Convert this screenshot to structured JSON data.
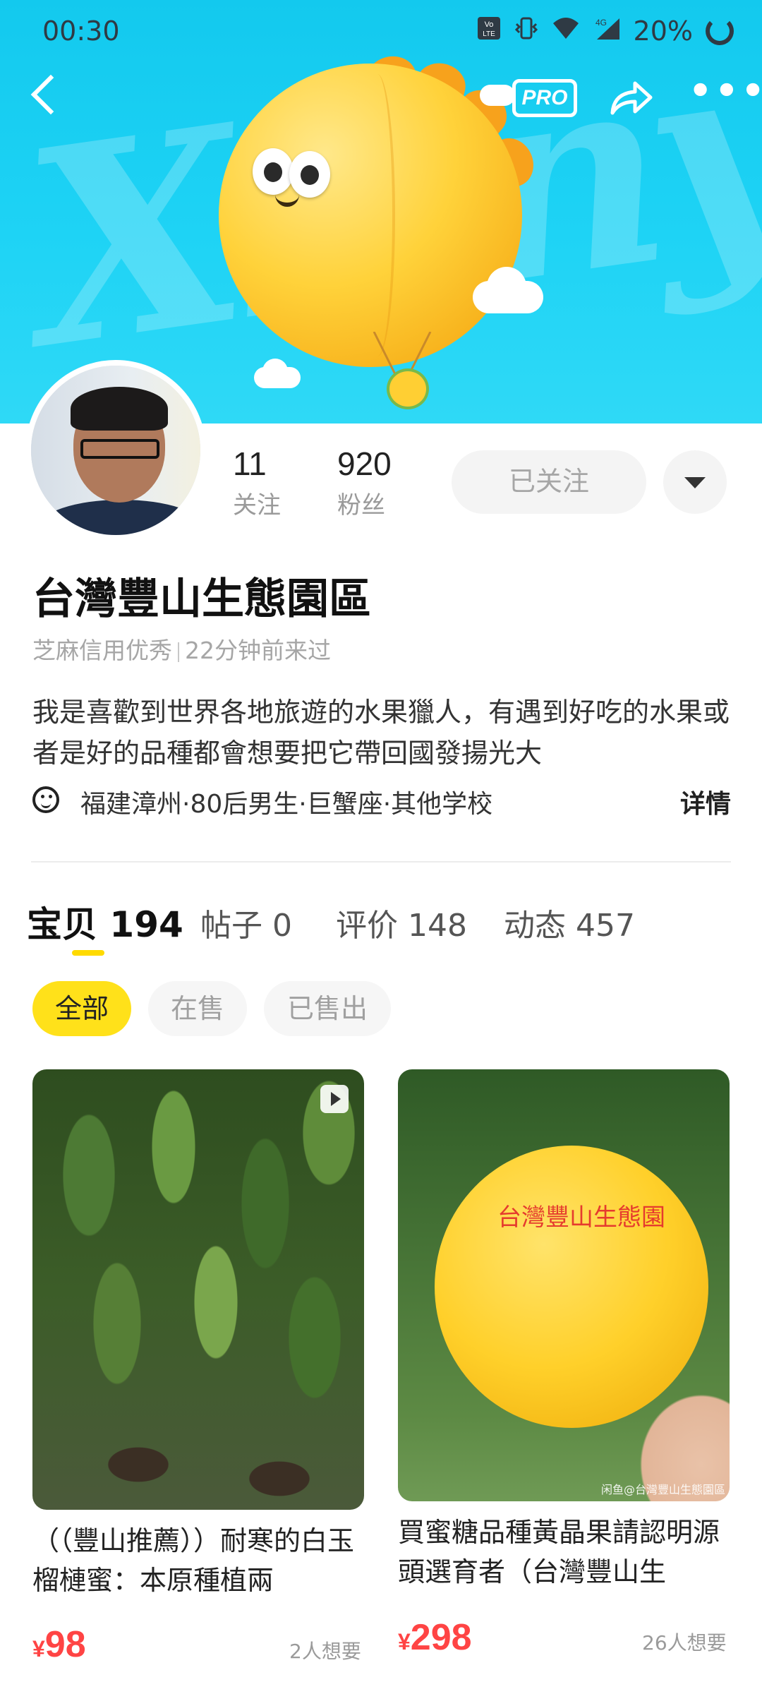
{
  "status_bar": {
    "time": "00:30",
    "battery": "20%",
    "icons": [
      "volte-icon",
      "vibrate-icon",
      "wifi-icon",
      "4g-signal-icon",
      "battery-ring-icon"
    ]
  },
  "nav": {
    "pro_label": "PRO",
    "icons": [
      "back-arrow-icon",
      "share-icon",
      "more-dots-icon"
    ]
  },
  "banner": {
    "watermark": "Xianyu"
  },
  "profile": {
    "following_count": "11",
    "following_label": "关注",
    "fans_count": "920",
    "fans_label": "粉丝",
    "follow_button": "已关注",
    "name": "台灣豐山生態園區",
    "credit": "芝麻信用优秀",
    "last_seen": "22分钟前来过",
    "bio": "我是喜歡到世界各地旅遊的水果獵人，有遇到好吃的水果或者是好的品種都會想要把它帶回國發揚光大",
    "tags": "福建漳州·80后男生·巨蟹座·其他学校",
    "detail_link": "详情"
  },
  "tabs": [
    {
      "label": "宝贝",
      "count": "194"
    },
    {
      "label": "帖子",
      "count": "0"
    },
    {
      "label": "评价",
      "count": "148"
    },
    {
      "label": "动态",
      "count": "457"
    }
  ],
  "filters": [
    "全部",
    "在售",
    "已售出"
  ],
  "items": [
    {
      "title": "（（豐山推薦））耐寒的白玉榴槤蜜：本原種植兩",
      "currency": "¥",
      "price": "98",
      "wants": "2人想要"
    },
    {
      "title": "買蜜糖品種黃晶果請認明源頭選育者（台灣豐山生",
      "image_label": "台灣豐山生態園",
      "image_watermark": "闲鱼@台灣豐山生態園區",
      "currency": "¥",
      "price": "298",
      "wants": "26人想要"
    }
  ],
  "colors": {
    "banner": "#1ed3f5",
    "accent_yellow": "#ffe11a",
    "price_red": "#ff4444"
  }
}
